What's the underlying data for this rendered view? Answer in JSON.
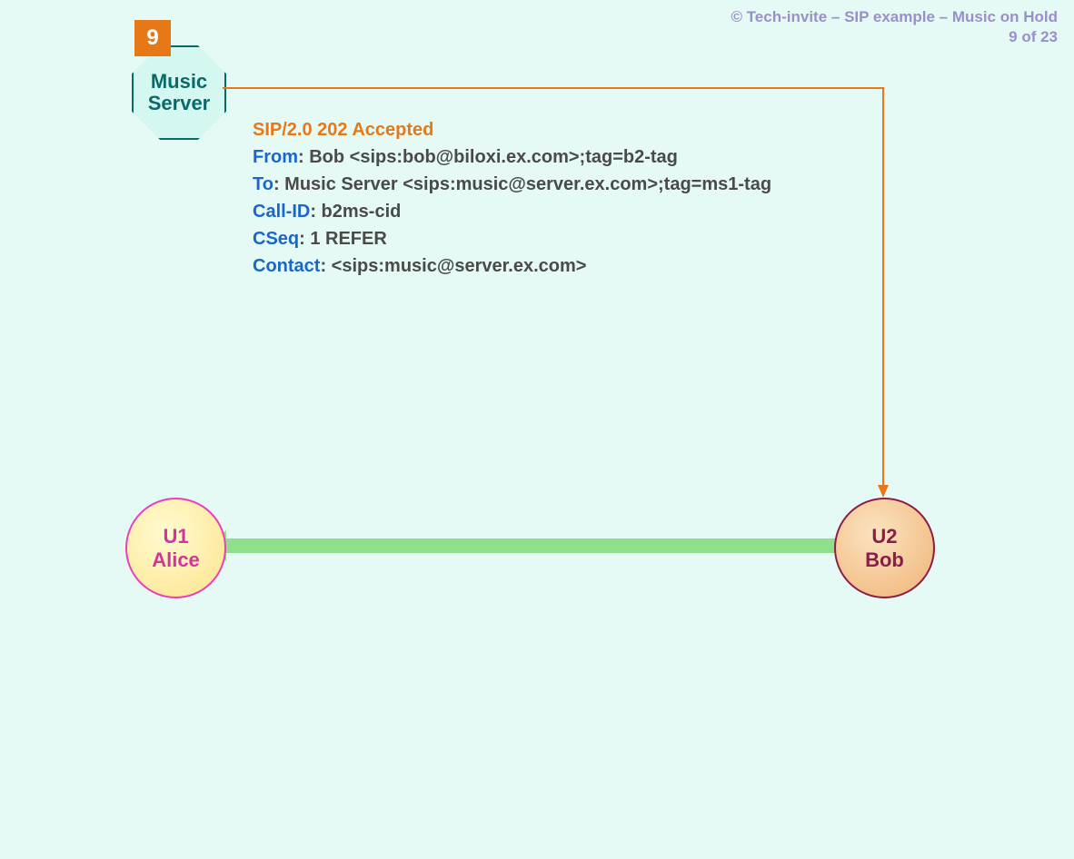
{
  "header": {
    "copyright": "© Tech-invite – SIP example – Music on Hold",
    "pager": "9 of 23"
  },
  "step": {
    "number": "9"
  },
  "music_server": {
    "line1": "Music",
    "line2": "Server"
  },
  "sip": {
    "title": "SIP/2.0 202 Accepted",
    "from_label": "From",
    "from_value": ": Bob <sips:bob@biloxi.ex.com>;tag=b2-tag",
    "to_label": "To",
    "to_value": ": Music Server <sips:music@server.ex.com>;tag=ms1-tag",
    "callid_label": "Call-ID",
    "callid_value": ": b2ms-cid",
    "cseq_label": "CSeq",
    "cseq_value": ": 1 REFER",
    "contact_label": "Contact",
    "contact_value": ": <sips:music@server.ex.com>"
  },
  "node_alice": {
    "line1": "U1",
    "line2": "Alice"
  },
  "node_bob": {
    "line1": "U2",
    "line2": "Bob"
  }
}
